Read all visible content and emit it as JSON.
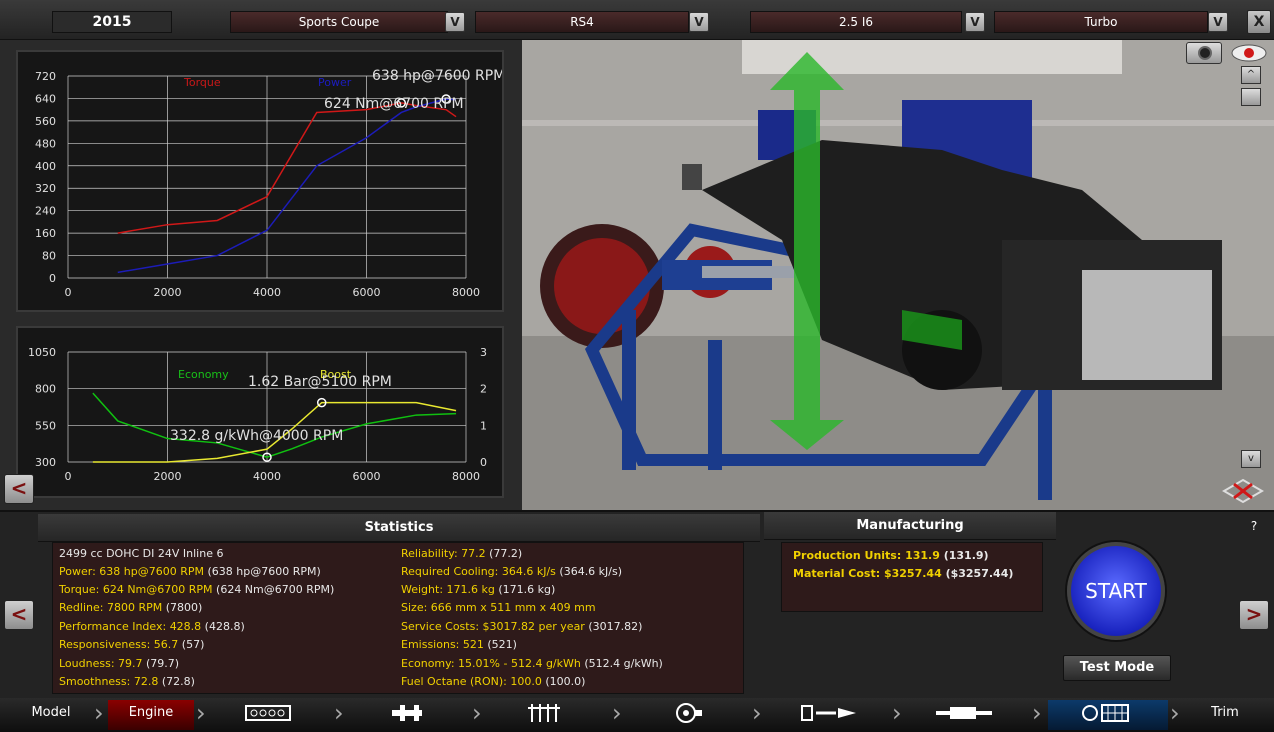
{
  "topbar": {
    "year": "2015",
    "body_style": "Sports Coupe",
    "model": "RS4",
    "engine_family": "2.5 I6",
    "aspiration": "Turbo",
    "dropdown_glyph": "V",
    "close_glyph": "X"
  },
  "power_graph": {
    "label_torque": "Torque",
    "label_power": "Power",
    "peak_power": "638 hp@7600 RPM",
    "peak_torque": "624 Nm@6700 RPM",
    "y_ticks": [
      "720",
      "640",
      "560",
      "480",
      "400",
      "320",
      "240",
      "160",
      "80",
      "0"
    ],
    "x_ticks": [
      "0",
      "2000",
      "4000",
      "6000",
      "8000"
    ]
  },
  "econ_graph": {
    "label_economy": "Economy",
    "label_boost": "Boost",
    "peak_boost": "1.62 Bar@5100 RPM",
    "best_econ": "332.8 g/kWh@4000 RPM",
    "y_ticks_left": [
      "1050",
      "800",
      "550",
      "300"
    ],
    "y_ticks_right": [
      "3",
      "2",
      "1",
      "0"
    ],
    "x_ticks": [
      "0",
      "2000",
      "4000",
      "6000",
      "8000"
    ]
  },
  "chart_data": [
    {
      "type": "line",
      "x": [
        1000,
        2000,
        3000,
        4000,
        5000,
        6000,
        6700,
        7000,
        7600,
        7800
      ],
      "series": [
        {
          "name": "Torque",
          "color": "#d01818",
          "values": [
            160,
            190,
            205,
            290,
            590,
            600,
            624,
            615,
            600,
            575
          ]
        },
        {
          "name": "Power",
          "color": "#1c1cb8",
          "values": [
            20,
            50,
            80,
            170,
            400,
            500,
            590,
            610,
            638,
            635
          ]
        }
      ],
      "ylim": [
        0,
        720
      ],
      "xlim": [
        0,
        8000
      ]
    },
    {
      "type": "line",
      "x": [
        500,
        1000,
        2000,
        3000,
        4000,
        4500,
        5100,
        6000,
        7000,
        7800
      ],
      "series": [
        {
          "name": "Economy",
          "color": "#10c010",
          "axis": "left",
          "values": [
            770,
            580,
            460,
            430,
            332.8,
            390,
            470,
            560,
            620,
            630
          ]
        },
        {
          "name": "Boost",
          "color": "#e8e830",
          "axis": "right",
          "values": [
            0,
            0,
            0,
            0.1,
            0.35,
            0.9,
            1.62,
            1.62,
            1.62,
            1.4
          ]
        }
      ],
      "ylim_left": [
        300,
        1050
      ],
      "ylim_right": [
        0,
        3
      ],
      "xlim": [
        0,
        8000
      ]
    }
  ],
  "viewport": {
    "scroll_up": "^",
    "scroll_down": "v"
  },
  "nav": {
    "prev": "<",
    "next": ">"
  },
  "statistics": {
    "title": "Statistics",
    "left": [
      {
        "main": "2499 cc DOHC DI 24V Inline 6",
        "paren": ""
      },
      {
        "main": "Power: 638 hp@7600 RPM",
        "paren": " (638 hp@7600 RPM)"
      },
      {
        "main": "Torque: 624 Nm@6700 RPM",
        "paren": " (624 Nm@6700 RPM)"
      },
      {
        "main": "Redline: 7800 RPM",
        "paren": " (7800)"
      },
      {
        "main": "Performance Index: 428.8",
        "paren": " (428.8)"
      },
      {
        "main": "Responsiveness: 56.7",
        "paren": " (57)"
      },
      {
        "main": "Loudness: 79.7",
        "paren": " (79.7)"
      },
      {
        "main": "Smoothness: 72.8",
        "paren": " (72.8)"
      }
    ],
    "right": [
      {
        "main": "Reliability: 77.2",
        "paren": " (77.2)"
      },
      {
        "main": "Required Cooling: 364.6 kJ/s",
        "paren": " (364.6 kJ/s)"
      },
      {
        "main": "Weight: 171.6 kg",
        "paren": " (171.6 kg)"
      },
      {
        "main": "Size: 666 mm x 511 mm x 409 mm",
        "paren": ""
      },
      {
        "main": "Service Costs: $3017.82 per year",
        "paren": " (3017.82)"
      },
      {
        "main": "Emissions: 521",
        "paren": " (521)"
      },
      {
        "main": "Economy: 15.01% - 512.4 g/kWh",
        "paren": " (512.4 g/kWh)"
      },
      {
        "main": "Fuel Octane (RON): 100.0",
        "paren": " (100.0)"
      }
    ]
  },
  "manufacturing": {
    "title": "Manufacturing",
    "help": "?",
    "production_units": "Production Units: 131.9",
    "production_units_paren": " (131.9)",
    "material_cost": "Material Cost: $3257.44",
    "material_cost_paren": " ($3257.44)",
    "start": "START",
    "test_mode": "Test Mode"
  },
  "tabs": {
    "model": "Model",
    "engine": "Engine",
    "trim": "Trim"
  }
}
